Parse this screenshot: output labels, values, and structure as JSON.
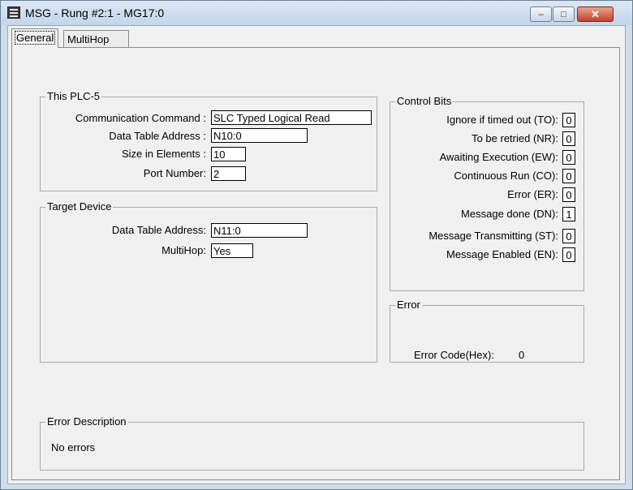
{
  "window": {
    "title": "MSG - Rung #2:1 - MG17:0",
    "minimize_glyph": "–",
    "maximize_glyph": "□",
    "close_glyph": "✕"
  },
  "tabs": [
    {
      "label": "General"
    },
    {
      "label": "MultiHop"
    }
  ],
  "this_plc": {
    "legend": "This PLC-5",
    "communication_command": {
      "label": "Communication Command :",
      "value": "SLC Typed Logical Read"
    },
    "data_table_address": {
      "label": "Data Table Address :",
      "value": "N10:0"
    },
    "size_in_elements": {
      "label": "Size in Elements :",
      "value": "10"
    },
    "port_number": {
      "label": "Port Number:",
      "value": "2"
    }
  },
  "target_device": {
    "legend": "Target Device",
    "data_table_address": {
      "label": "Data Table Address:",
      "value": "N11:0"
    },
    "multihop": {
      "label": "MultiHop:",
      "value": "Yes"
    }
  },
  "control_bits": {
    "legend": "Control Bits",
    "items": [
      {
        "label": "Ignore if timed out (TO):",
        "value": "0"
      },
      {
        "label": "To be retried (NR):",
        "value": "0"
      },
      {
        "label": "Awaiting Execution (EW):",
        "value": "0"
      },
      {
        "label": "Continuous Run (CO):",
        "value": "0"
      },
      {
        "label": "Error (ER):",
        "value": "0"
      },
      {
        "label": "Message done (DN):",
        "value": "1"
      },
      {
        "label": "Message Transmitting (ST):",
        "value": "0"
      },
      {
        "label": "Message Enabled (EN):",
        "value": "0"
      }
    ]
  },
  "error": {
    "legend": "Error",
    "code_label": "Error Code(Hex):",
    "code_value": "0"
  },
  "error_description": {
    "legend": "Error Description",
    "text": "No errors"
  }
}
